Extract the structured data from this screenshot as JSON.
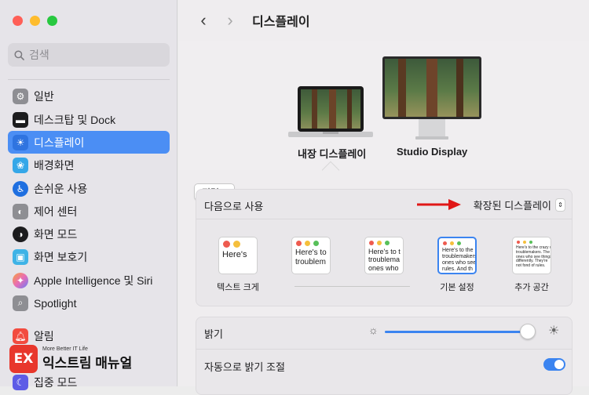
{
  "window_controls": {
    "close_color": "#ff5f57",
    "minimize_color": "#febc2e",
    "zoom_color": "#28c840"
  },
  "search": {
    "placeholder": "검색"
  },
  "sidebar": {
    "items": [
      {
        "label": "일반",
        "icon": "gear-icon",
        "color": "#8e8e93"
      },
      {
        "label": "데스크탑 및 Dock",
        "icon": "dock-icon",
        "color": "#1c1c1e"
      },
      {
        "label": "디스플레이",
        "icon": "sun-icon",
        "color": "#3b84f0",
        "active": true
      },
      {
        "label": "배경화면",
        "icon": "flower-icon",
        "color": "#35a7e8"
      },
      {
        "label": "손쉬운 사용",
        "icon": "accessibility-icon",
        "color": "#1f6fe0"
      },
      {
        "label": "제어 센터",
        "icon": "control-center-icon",
        "color": "#8e8e93"
      },
      {
        "label": "화면 모드",
        "icon": "appearance-icon",
        "color": "#1c1c1e"
      },
      {
        "label": "화면 보호기",
        "icon": "screensaver-icon",
        "color": "#3fb3e6"
      },
      {
        "label": "Apple Intelligence 및 Siri",
        "icon": "siri-icon",
        "color": "#e96cb4"
      },
      {
        "label": "Spotlight",
        "icon": "search-icon",
        "color": "#8e8e93"
      },
      {
        "label": "알림",
        "icon": "bell-icon",
        "color": "#f24b3f"
      },
      {
        "label": "집중 모드",
        "icon": "moon-icon",
        "color": "#5e5ce6"
      }
    ]
  },
  "header": {
    "title": "디스플레이",
    "back": "‹",
    "forward": "›"
  },
  "displays": {
    "arrange_label": "정렬...",
    "items": [
      {
        "label": "내장 디스플레이"
      },
      {
        "label": "Studio Display"
      }
    ]
  },
  "use_as": {
    "label": "다음으로 사용",
    "value": "확장된 디스플레이"
  },
  "resolution_options": [
    {
      "preview": "Here's",
      "label": "텍스트 크게",
      "selected": false
    },
    {
      "preview": "Here's to\ntroublem",
      "label": "",
      "selected": false
    },
    {
      "preview": "Here's to t\ntroublema\nones who",
      "label": "",
      "selected": false
    },
    {
      "preview": "Here's to the\ntroublemakers.\nones who see t\nrules. And th",
      "label": "기본 설정",
      "selected": true
    },
    {
      "preview": "Here's to the crazy ones\ntroublemakers. The\nones who see things\ndifferently. They're\nnot fond of rules.",
      "label": "추가 공간",
      "selected": false
    }
  ],
  "brightness": {
    "label": "밝기",
    "level": 0.95
  },
  "auto_brightness": {
    "label": "자동으로 밝기 조절",
    "enabled": true
  },
  "watermark": {
    "tag": "More Better IT Life",
    "name": "익스트림 매뉴얼",
    "logo": "EX"
  }
}
